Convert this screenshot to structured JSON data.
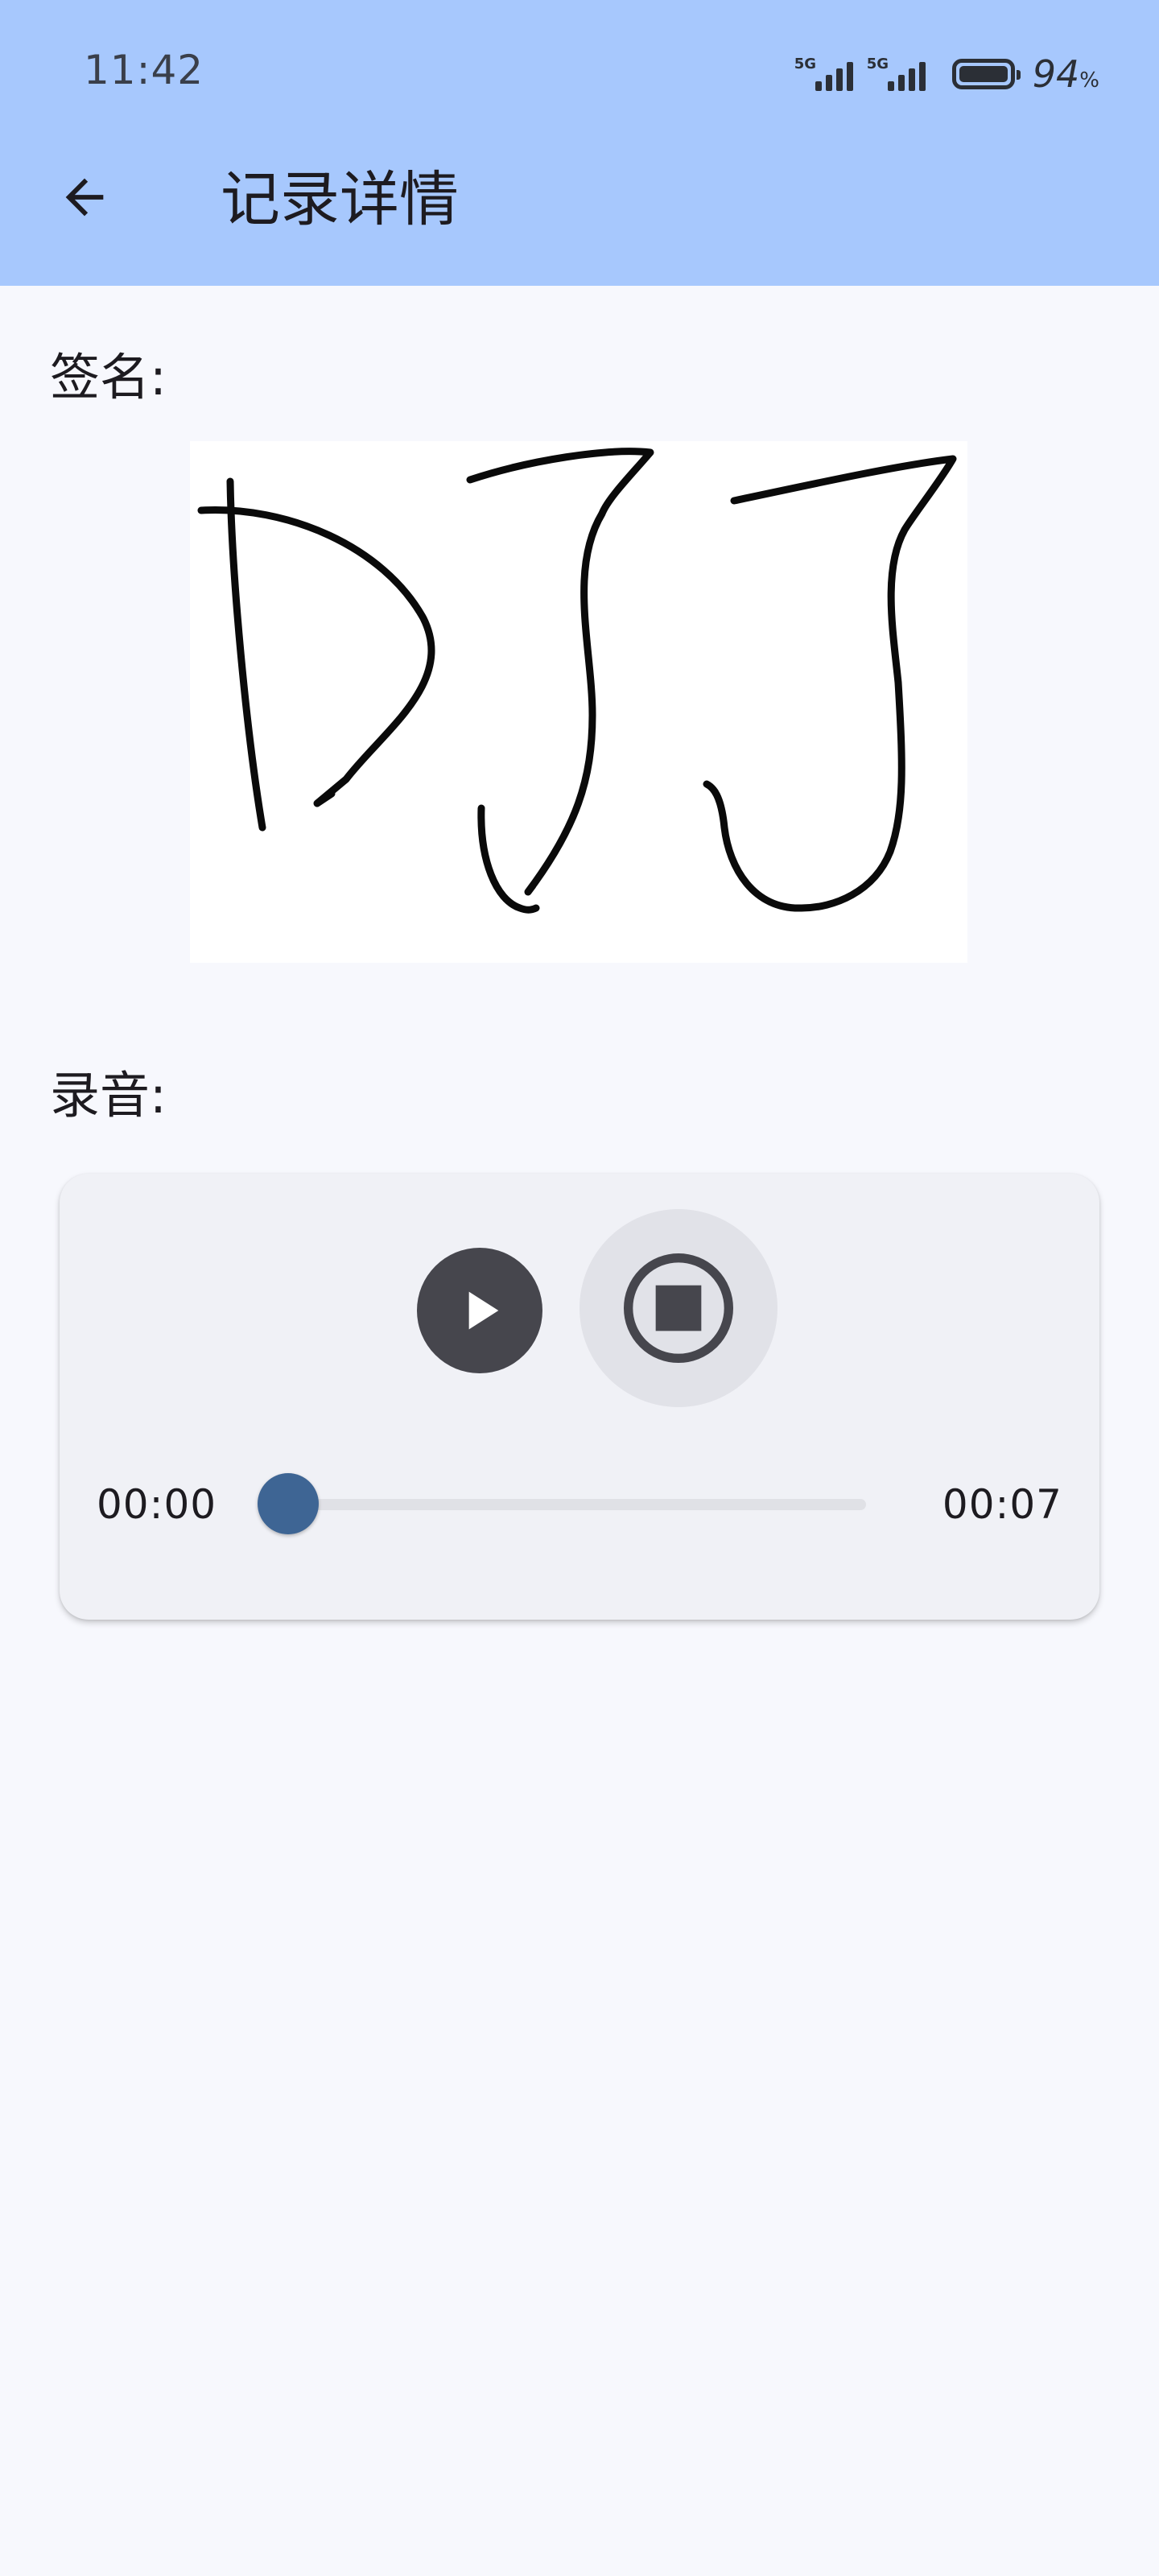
{
  "status_bar": {
    "time": "11:42",
    "network_1": "5G",
    "network_2": "5G",
    "battery_percent": "94",
    "battery_unit": "%"
  },
  "app_bar": {
    "back_icon": "arrow-back-icon",
    "title": "记录详情"
  },
  "signature_section": {
    "label": "签名:",
    "handwriting": "DJJ"
  },
  "recording_section": {
    "label": "录音:",
    "player": {
      "play_icon": "play-icon",
      "stop_icon": "stop-circle-icon",
      "current_time": "00:00",
      "total_time": "00:07",
      "progress_fraction": 0
    }
  },
  "colors": {
    "header_bg": "#a7c8fd",
    "page_bg": "#f7f8fd",
    "accent": "#3e6594",
    "play_button": "#46464d",
    "stop_button_bg": "#e1e2e8"
  }
}
